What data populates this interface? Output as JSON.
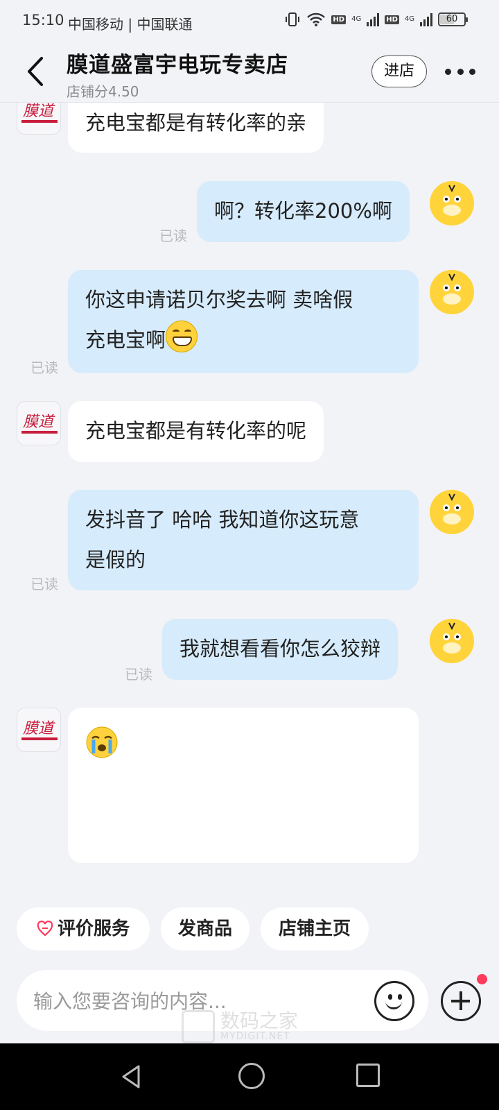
{
  "status_bar": {
    "time": "15:10",
    "carriers": "中国移动 | 中国联通",
    "battery": "60",
    "hd": "HD",
    "net": "4G"
  },
  "header": {
    "title": "膜道盛富宇电玩专卖店",
    "score": "店铺分4.50",
    "enter_label": "进店"
  },
  "messages": [
    {
      "side": "in",
      "text": "充电宝都是有转化率的亲"
    },
    {
      "side": "out",
      "text": "啊？转化率200%啊",
      "status": "已读"
    },
    {
      "side": "out",
      "lines": [
        "你这申请诺贝尔奖去啊 卖啥假",
        "充电宝啊"
      ],
      "status": "已读",
      "emoji": "grin"
    },
    {
      "side": "in",
      "text": "充电宝都是有转化率的呢"
    },
    {
      "side": "out",
      "lines": [
        "发抖音了 哈哈 我知道你这玩意",
        "是假的"
      ],
      "status": "已读"
    },
    {
      "side": "out",
      "text": "我就想看看你怎么狡辩",
      "status": "已读"
    },
    {
      "side": "in",
      "emoji": "crying"
    }
  ],
  "quick_actions": [
    "评价服务",
    "发商品",
    "店铺主页"
  ],
  "input": {
    "placeholder": "输入您要咨询的内容..."
  },
  "colors": {
    "incoming_bubble": "#ffffff",
    "outgoing_bubble": "#d6ebfb",
    "accent_red": "#ff3b5c",
    "user_avatar": "#ffd43a"
  }
}
